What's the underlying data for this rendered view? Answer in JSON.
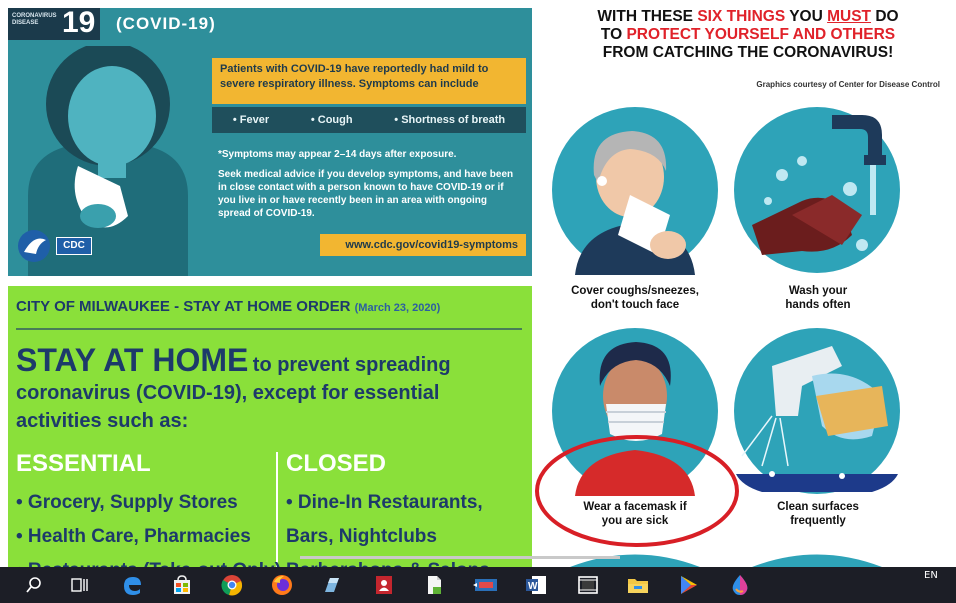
{
  "cdc_panel": {
    "header_small": "CORONAVIRUS\nDISEASE",
    "header_number": "19",
    "header_title": "(COVID-19)",
    "yellow_text": "Patients with COVID-19 have reportedly had mild to severe respiratory illness. Symptoms can include",
    "symptoms": [
      "• Fever",
      "• Cough",
      "• Shortness of breath"
    ],
    "note_1": "*Symptoms may appear 2–14 days after exposure.",
    "note_2": "Seek medical advice if you develop symptoms, and have been in close contact with a person known to have COVID-19 or if you live in or have recently been in an area with ongoing spread of COVID-19.",
    "url": "www.cdc.gov/covid19-symptoms",
    "logo_text": "CDC"
  },
  "milwaukee_panel": {
    "title": "CITY OF MILWAUKEE - STAY AT HOME ORDER",
    "date": "(March 23, 2020)",
    "headline_big": "STAY AT HOME",
    "headline_rest": "to prevent spreading",
    "headline_line2": "coronavirus (COVID-19), except for essential",
    "headline_line3": "activities such as:",
    "essential_heading": "ESSENTIAL",
    "closed_heading": "CLOSED",
    "essential_items": [
      "• Grocery, Supply Stores",
      "• Health Care, Pharmacies",
      "• Restaurants (Take-out Only)"
    ],
    "closed_items": [
      "• Dine-In Restaurants,",
      "  Bars, Nightclubs",
      "  Barbershops & Salons"
    ]
  },
  "poster": {
    "heading_1a": "WITH THESE ",
    "heading_1b": "SIX THINGS",
    "heading_1c": " YOU ",
    "heading_1d": "MUST",
    "heading_1e": " DO",
    "heading_2a": "TO ",
    "heading_2b": "PROTECT YOURSELF AND OTHERS",
    "heading_3": "FROM CATCHING THE CORONAVIRUS!",
    "credit": "Graphics courtesy of Center for Disease Control",
    "captions": {
      "cover_1": "Cover coughs/sneezes,",
      "cover_2": "don't touch face",
      "wash_1": "Wash your",
      "wash_2": "hands often",
      "mask_1": "Wear a facemask if",
      "mask_2": "you are sick",
      "clean_1": "Clean surfaces",
      "clean_2": "frequently"
    },
    "highlight_color": "#d81f26"
  },
  "taskbar": {
    "icons": [
      "search-icon",
      "task-view-icon",
      "edge-icon",
      "store-icon",
      "chrome-icon",
      "firefox-icon",
      "app-icon",
      "contacts-icon",
      "notepad-icon",
      "media-icon",
      "word-icon",
      "photos-icon",
      "file-explorer-icon",
      "play-icon",
      "paint-icon"
    ],
    "language": "EN"
  }
}
